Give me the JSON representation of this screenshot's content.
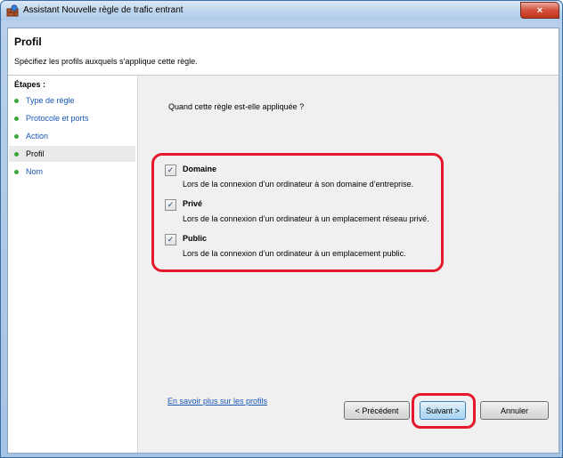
{
  "window": {
    "title": "Assistant Nouvelle règle de trafic entrant",
    "close_symbol": "×",
    "title_icon": "firewall-shield-icon"
  },
  "header": {
    "title": "Profil",
    "subtitle": "Spécifiez les profils auxquels s’applique cette règle."
  },
  "sidebar": {
    "title": "Étapes :",
    "steps": [
      {
        "label": "Type de règle"
      },
      {
        "label": "Protocole et ports"
      },
      {
        "label": "Action"
      },
      {
        "label": "Profil",
        "current": true
      },
      {
        "label": "Nom"
      }
    ]
  },
  "main": {
    "question": "Quand cette règle est-elle appliquée ?",
    "options": [
      {
        "name": "Domaine",
        "checked": true,
        "description": "Lors de la connexion d’un ordinateur à son domaine d’entreprise."
      },
      {
        "name": "Privé",
        "checked": true,
        "description": "Lors de la connexion d’un ordinateur à un emplacement réseau privé."
      },
      {
        "name": "Public",
        "checked": true,
        "description": "Lors de la connexion d’un ordinateur à un emplacement public."
      }
    ],
    "checkmark": "✓",
    "learn_more": "En savoir plus sur les profils"
  },
  "buttons": {
    "previous": "< Précédent",
    "next": "Suivant >",
    "cancel": "Annuler"
  },
  "colors": {
    "highlight": "#e5192b",
    "link": "#1a56b6",
    "step_dot": "#3aa93a"
  }
}
